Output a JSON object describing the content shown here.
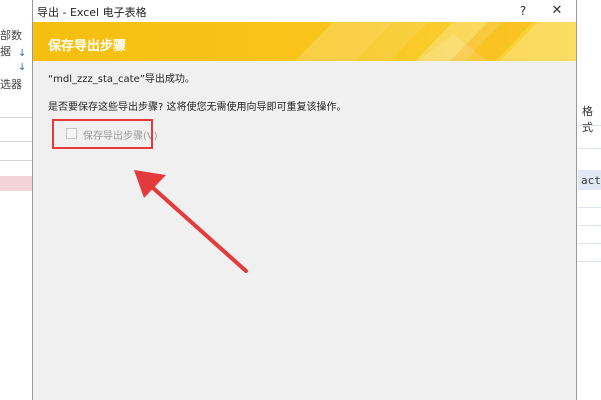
{
  "background": {
    "left_label_top": "部数据",
    "left_glyph_1": "↓",
    "left_glyph_2": "↓",
    "left_label_bottom": "选器",
    "right_label": "格式",
    "right_cell_text": "act"
  },
  "dialog": {
    "title": "导出 - Excel 电子表格",
    "help_label": "?",
    "close_label": "✕",
    "banner_title": "保存导出步骤",
    "success_message": "“mdl_zzz_sta_cate”导出成功。",
    "question": "是否要保存这些导出步骤? 这将使您无需使用向导即可重复该操作。",
    "save_steps_label": "保存导出步骤(V)",
    "save_steps_checked": false,
    "save_steps_enabled": false
  },
  "colors": {
    "banner_yellow": "#f6bf0f",
    "annotation_red": "#e33b3b",
    "dialog_bg": "#f0f0f0"
  }
}
